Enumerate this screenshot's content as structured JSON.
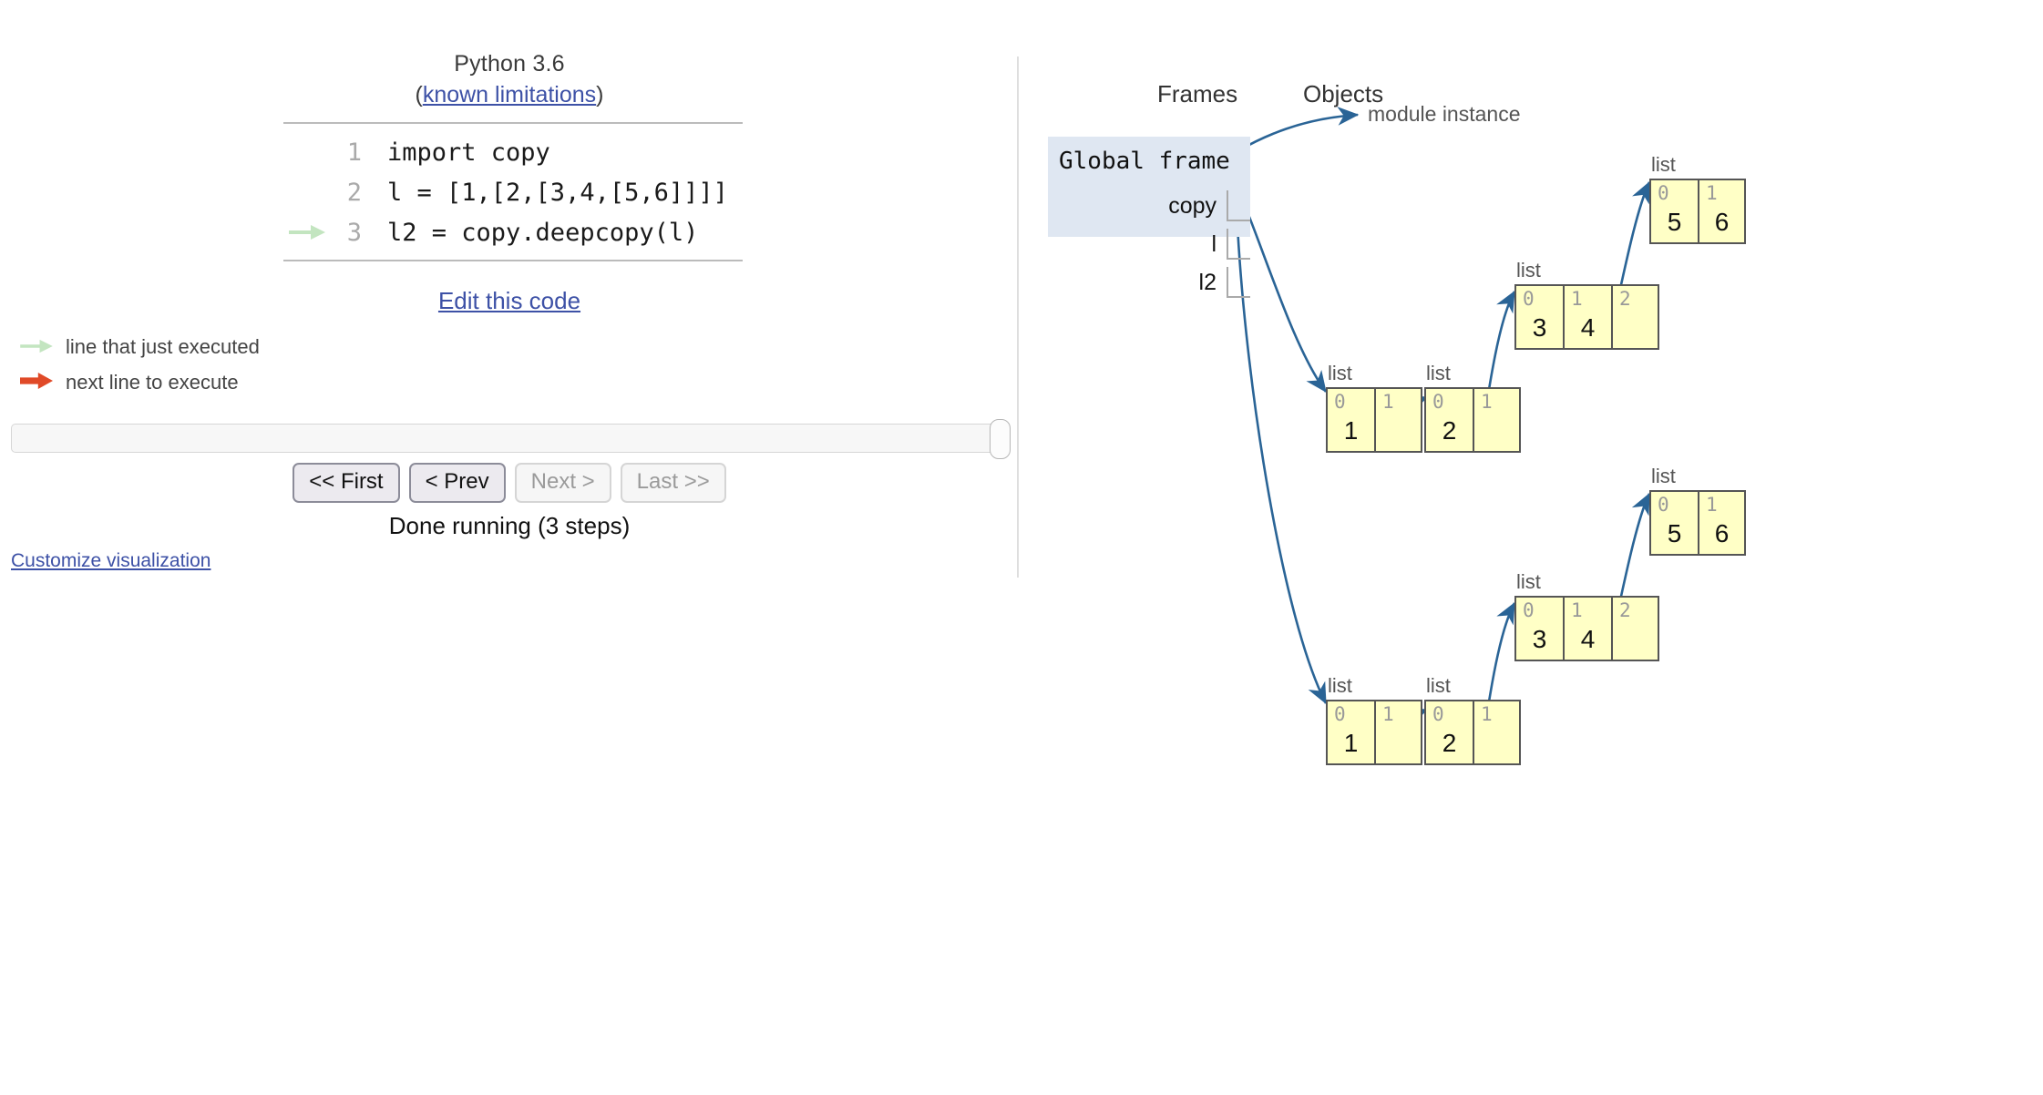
{
  "left": {
    "python_version": "Python 3.6",
    "limits_prefix": "(",
    "limits_link": "known limitations",
    "limits_suffix": ")",
    "code_lines": [
      {
        "num": "1",
        "text": "import copy",
        "marker": "none"
      },
      {
        "num": "2",
        "text": "l = [1,[2,[3,4,[5,6]]]]",
        "marker": "none"
      },
      {
        "num": "3",
        "text": "l2 = copy.deepcopy(l)",
        "marker": "just-executed"
      }
    ],
    "edit_link": "Edit this code",
    "legend": [
      {
        "icon": "green-arrow-icon",
        "label": "line that just executed"
      },
      {
        "icon": "red-arrow-icon",
        "label": "next line to execute"
      }
    ],
    "buttons": [
      {
        "label": "<< First",
        "enabled": true
      },
      {
        "label": "< Prev",
        "enabled": true
      },
      {
        "label": "Next >",
        "enabled": false
      },
      {
        "label": "Last >>",
        "enabled": false
      }
    ],
    "status": "Done running (3 steps)",
    "customize_link": "Customize visualization",
    "slider_position_percent": 100
  },
  "right": {
    "frames_header": "Frames",
    "objects_header": "Objects",
    "global_frame": {
      "title": "Global frame",
      "variables": [
        {
          "name": "copy",
          "target": "module instance"
        },
        {
          "name": "l",
          "target": "list-top-outer"
        },
        {
          "name": "l2",
          "target": "list-bottom-outer"
        }
      ]
    },
    "module_instance_label": "module instance",
    "objects": [
      {
        "id": "top-outer",
        "type": "list",
        "cells": [
          {
            "idx": "0",
            "val": "1"
          },
          {
            "idx": "1",
            "val": ""
          }
        ]
      },
      {
        "id": "top-2",
        "type": "list",
        "cells": [
          {
            "idx": "0",
            "val": "2"
          },
          {
            "idx": "1",
            "val": ""
          }
        ]
      },
      {
        "id": "top-34",
        "type": "list",
        "cells": [
          {
            "idx": "0",
            "val": "3"
          },
          {
            "idx": "1",
            "val": "4"
          },
          {
            "idx": "2",
            "val": ""
          }
        ]
      },
      {
        "id": "top-56",
        "type": "list",
        "cells": [
          {
            "idx": "0",
            "val": "5"
          },
          {
            "idx": "1",
            "val": "6"
          }
        ]
      },
      {
        "id": "bot-outer",
        "type": "list",
        "cells": [
          {
            "idx": "0",
            "val": "1"
          },
          {
            "idx": "1",
            "val": ""
          }
        ]
      },
      {
        "id": "bot-2",
        "type": "list",
        "cells": [
          {
            "idx": "0",
            "val": "2"
          },
          {
            "idx": "1",
            "val": ""
          }
        ]
      },
      {
        "id": "bot-34",
        "type": "list",
        "cells": [
          {
            "idx": "0",
            "val": "3"
          },
          {
            "idx": "1",
            "val": "4"
          },
          {
            "idx": "2",
            "val": ""
          }
        ]
      },
      {
        "id": "bot-56",
        "type": "list",
        "cells": [
          {
            "idx": "0",
            "val": "5"
          },
          {
            "idx": "1",
            "val": "6"
          }
        ]
      }
    ]
  },
  "colors": {
    "frame_bg": "#dfe7f2",
    "object_cell_bg": "#ffffc6",
    "pointer_arrow": "#2a6496",
    "link": "#3d51a6",
    "green_arrow": "#c3e5c0",
    "red_arrow": "#e04a28"
  }
}
